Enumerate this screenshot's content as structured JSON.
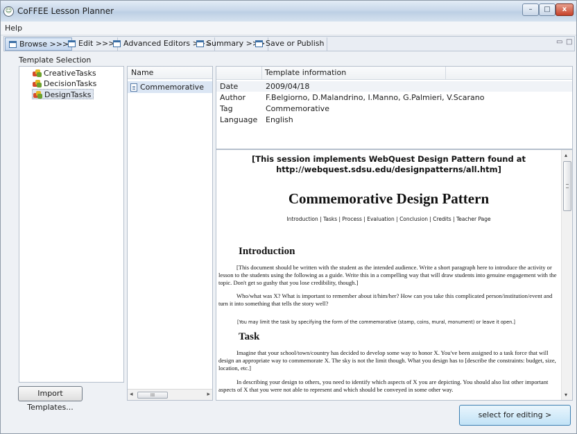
{
  "window": {
    "title": "CoFFEE Lesson Planner",
    "minimize": "–",
    "maximize": "□",
    "close": "x"
  },
  "menu": {
    "help": "Help"
  },
  "tabs": [
    {
      "label": "Browse >>>"
    },
    {
      "label": "Edit >>>"
    },
    {
      "label": "Advanced Editors >>>"
    },
    {
      "label": "Summary >>>"
    },
    {
      "label": "Save or Publish"
    }
  ],
  "view_controls": {
    "minimize": "▭",
    "maximize": "□"
  },
  "template_selection": {
    "label": "Template Selection",
    "items": [
      "CreativeTasks",
      "DecisionTasks",
      "DesignTasks"
    ],
    "selected": "DesignTasks",
    "import_button": "Import Templates..."
  },
  "name_list": {
    "header": "Name",
    "items": [
      "Commemorative"
    ],
    "scroll_thumb": "III",
    "scroll_left": "◂",
    "scroll_right": "▸"
  },
  "template_info": {
    "header": "Template information",
    "rows": [
      {
        "key": "Date",
        "value": "2009/04/18"
      },
      {
        "key": "Author",
        "value": "F.Belgiorno, D.Malandrino, I.Manno, G.Palmieri, V.Scarano"
      },
      {
        "key": "Tag",
        "value": "Commemorative"
      },
      {
        "key": "Language",
        "value": "English"
      }
    ]
  },
  "document": {
    "banner_line1": "[This session implements WebQuest Design Pattern found at",
    "banner_line2": "http://webquest.sdsu.edu/designpatterns/all.htm]",
    "title": "Commemorative Design Pattern",
    "nav": "Introduction | Tasks | Process | Evaluation | Conclusion | Credits | Teacher Page",
    "intro_heading": "Introduction",
    "intro_p1": "[This document should be written with the student as the intended audience. Write a short paragraph here to introduce the activity or lesson to the students using the following as a guide. Write this in a compelling way that will draw students into genuine engagement with the topic. Don't get so gushy that you lose credibility, though.]",
    "intro_p2": "Who/what was X? What is important to remember about it/him/her? How can you take this complicated person/institution/event and turn it into something that tells the story well?",
    "intro_note": "[You may limit the task by specifying the form of the commemorative (stamp, coins, mural, monument) or leave it open.]",
    "task_heading": "Task",
    "task_p1": "Imagine that your school/town/country has decided to develop some way to honor X. You've been assigned to a task force that will design an appropriate way to commemorate X. The sky is not the limit though. What you design has to [describe the constraints: budget, size, location, etc.]",
    "task_p2": "In describing your design to others, you need to identify which aspects of X you are depicting. You should also list other important aspects of X that you were not able to represent and which should be conveyed in some other way."
  },
  "scrollbar": {
    "up": "▴",
    "down": "▾"
  },
  "actions": {
    "select_for_editing": "select for editing >"
  }
}
